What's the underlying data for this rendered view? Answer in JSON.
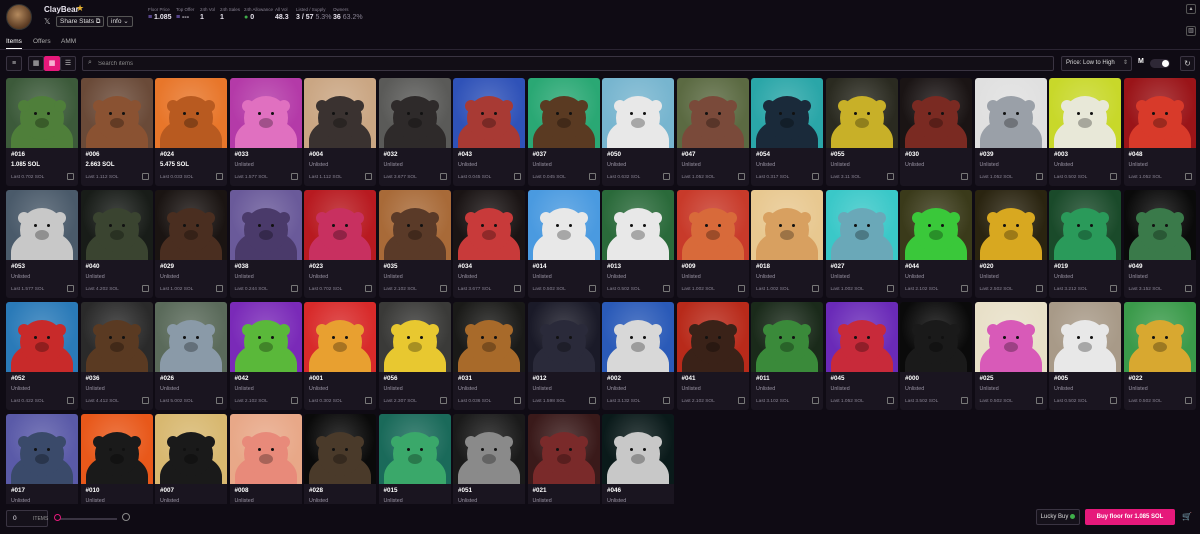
{
  "collection": {
    "name": "ClayBear",
    "star_icon": "star-icon",
    "social": "𝕏",
    "share_label": "Share Stats",
    "info_label": "info"
  },
  "stats": [
    {
      "label": "Floor Price",
      "value": "1.085",
      "dim": ""
    },
    {
      "label": "Top Offer",
      "value": "---",
      "dim": ""
    },
    {
      "label": "24h Vol",
      "value": "1",
      "dim": ""
    },
    {
      "label": "24h Sales",
      "value": "1",
      "dim": ""
    },
    {
      "label": "24h Allowance",
      "value": "0",
      "dim": ""
    },
    {
      "label": "All Vol",
      "value": "48.3",
      "dim": ""
    },
    {
      "label": "Listed / Supply",
      "value": "3 / 57",
      "dim": "5.3%"
    },
    {
      "label": "Owners",
      "value": "36",
      "dim": "63.2%"
    }
  ],
  "tabs": [
    {
      "label": "Items"
    },
    {
      "label": "Offers"
    },
    {
      "label": "AMM"
    }
  ],
  "toolbar": {
    "search_placeholder": "Search items",
    "sort_label": "Price: Low to High",
    "marketplace_mark": "M"
  },
  "colors": {
    "accent": "#e6197b",
    "bg": "#0f0b14",
    "card": "#1a1520"
  },
  "items": [
    {
      "id": "#016",
      "price": "1.085 SOL",
      "last": "Last 0.702 SOL",
      "bg": "#3c5a3a",
      "bear": "#4f7f3a"
    },
    {
      "id": "#006",
      "price": "2.663 SOL",
      "last": "Last 1.112 SOL",
      "bg": "#6a4a38",
      "bear": "#8a5232"
    },
    {
      "id": "#024",
      "price": "5.475 SOL",
      "last": "Last 0.033 SOL",
      "bg": "#e8762a",
      "bear": "#b85a20"
    },
    {
      "id": "#033",
      "price": "Unlisted",
      "last": "Last 1.577 SOL",
      "bg": "#b43aa8",
      "bear": "#e070c0"
    },
    {
      "id": "#004",
      "price": "Unlisted",
      "last": "Last 1.112 SOL",
      "bg": "#caa683",
      "bear": "#3a3230"
    },
    {
      "id": "#032",
      "price": "Unlisted",
      "last": "Last 3.677 SOL",
      "bg": "#5a5a58",
      "bear": "#2e2a2a"
    },
    {
      "id": "#043",
      "price": "Unlisted",
      "last": "Last 0.045 SOL",
      "bg": "#2f52b8",
      "bear": "#a83a34"
    },
    {
      "id": "#037",
      "price": "Unlisted",
      "last": "Last 0.045 SOL",
      "bg": "#2aa874",
      "bear": "#5a3a22"
    },
    {
      "id": "#050",
      "price": "Unlisted",
      "last": "Last 0.632 SOL",
      "bg": "#77b5cf",
      "bear": "#e8e8e8"
    },
    {
      "id": "#047",
      "price": "Unlisted",
      "last": "Last 1.052 SOL",
      "bg": "#5b6a42",
      "bear": "#7a4a3a"
    },
    {
      "id": "#054",
      "price": "Unlisted",
      "last": "Last 0.317 SOL",
      "bg": "#2aa6a8",
      "bear": "#1a2a3a"
    },
    {
      "id": "#055",
      "price": "Unlisted",
      "last": "Last 3.11 SOL",
      "bg": "#2a2a20",
      "bear": "#c8b028"
    },
    {
      "id": "#030",
      "price": "Unlisted",
      "last": "",
      "bg": "#1a1414",
      "bear": "#7a2a22"
    },
    {
      "id": "#039",
      "price": "Unlisted",
      "last": "Last 1.052 SOL",
      "bg": "#e0e0e0",
      "bear": "#9aa0a8"
    },
    {
      "id": "#003",
      "price": "Unlisted",
      "last": "Last 0.502 SOL",
      "bg": "#c8d82a",
      "bear": "#e8e8d8"
    },
    {
      "id": "#048",
      "price": "Unlisted",
      "last": "Last 1.052 SOL",
      "bg": "#9a1418",
      "bear": "#d83a2a"
    },
    {
      "id": "#053",
      "price": "Unlisted",
      "last": "Last 1.577 SOL",
      "bg": "#4a5a6a",
      "bear": "#c8c8c8"
    },
    {
      "id": "#040",
      "price": "Unlisted",
      "last": "Last 4.202 SOL",
      "bg": "#181c18",
      "bear": "#3a4430"
    },
    {
      "id": "#029",
      "price": "Unlisted",
      "last": "Last 1.002 SOL",
      "bg": "#1a1412",
      "bear": "#4a2e20"
    },
    {
      "id": "#038",
      "price": "Unlisted",
      "last": "Last 0.244 SOL",
      "bg": "#6a5a9a",
      "bear": "#4a3a6a"
    },
    {
      "id": "#023",
      "price": "Unlisted",
      "last": "Last 0.702 SOL",
      "bg": "#b81a20",
      "bear": "#c83060"
    },
    {
      "id": "#035",
      "price": "Unlisted",
      "last": "Last 2.102 SOL",
      "bg": "#a86a38",
      "bear": "#5a3a28"
    },
    {
      "id": "#034",
      "price": "Unlisted",
      "last": "Last 3.677 SOL",
      "bg": "#1a1414",
      "bear": "#c83a3a"
    },
    {
      "id": "#014",
      "price": "Unlisted",
      "last": "Last 0.502 SOL",
      "bg": "#4a9ae0",
      "bear": "#e8e8e8"
    },
    {
      "id": "#013",
      "price": "Unlisted",
      "last": "Last 0.502 SOL",
      "bg": "#2a6a3a",
      "bear": "#e8e8e8"
    },
    {
      "id": "#009",
      "price": "Unlisted",
      "last": "Last 1.002 SOL",
      "bg": "#c83a2a",
      "bear": "#d86a3a"
    },
    {
      "id": "#018",
      "price": "Unlisted",
      "last": "Last 1.002 SOL",
      "bg": "#e8c890",
      "bear": "#d8a060"
    },
    {
      "id": "#027",
      "price": "Unlisted",
      "last": "Last 1.002 SOL",
      "bg": "#3ac8c8",
      "bear": "#6aa8b8"
    },
    {
      "id": "#044",
      "price": "Unlisted",
      "last": "Last 2.102 SOL",
      "bg": "#3a3a1a",
      "bear": "#3ac83a"
    },
    {
      "id": "#020",
      "price": "Unlisted",
      "last": "Last 2.502 SOL",
      "bg": "#2a2410",
      "bear": "#d8a820"
    },
    {
      "id": "#019",
      "price": "Unlisted",
      "last": "Last 3.212 SOL",
      "bg": "#1a4a2a",
      "bear": "#2a9a5a"
    },
    {
      "id": "#049",
      "price": "Unlisted",
      "last": "Last 3.152 SOL",
      "bg": "#0a0a0a",
      "bear": "#3a7a4a"
    },
    {
      "id": "#052",
      "price": "Unlisted",
      "last": "Last 0.422 SOL",
      "bg": "#2a7ab8",
      "bear": "#c82a2a"
    },
    {
      "id": "#036",
      "price": "Unlisted",
      "last": "Last 4.412 SOL",
      "bg": "#2a2a2a",
      "bear": "#5a3a22"
    },
    {
      "id": "#026",
      "price": "Unlisted",
      "last": "Last 5.002 SOL",
      "bg": "#5a6a5a",
      "bear": "#8a9aa8"
    },
    {
      "id": "#042",
      "price": "Unlisted",
      "last": "Last 2.102 SOL",
      "bg": "#7a2ab8",
      "bear": "#5ab83a"
    },
    {
      "id": "#001",
      "price": "Unlisted",
      "last": "Last 0.302 SOL",
      "bg": "#d82a2a",
      "bear": "#e8a030"
    },
    {
      "id": "#056",
      "price": "Unlisted",
      "last": "Last 2.307 SOL",
      "bg": "#3a3a38",
      "bear": "#e8c830"
    },
    {
      "id": "#031",
      "price": "Unlisted",
      "last": "Last 0.036 SOL",
      "bg": "#1a1a18",
      "bear": "#a86a2a"
    },
    {
      "id": "#012",
      "price": "Unlisted",
      "last": "Last 1.598 SOL",
      "bg": "#1a1a28",
      "bear": "#2a2a3a"
    },
    {
      "id": "#002",
      "price": "Unlisted",
      "last": "Last 3.132 SOL",
      "bg": "#2a5ab8",
      "bear": "#d8d8d8"
    },
    {
      "id": "#041",
      "price": "Unlisted",
      "last": "Last 2.102 SOL",
      "bg": "#b82a1a",
      "bear": "#3a2218"
    },
    {
      "id": "#011",
      "price": "Unlisted",
      "last": "Last 3.102 SOL",
      "bg": "#1a2a1a",
      "bear": "#3a8a3a"
    },
    {
      "id": "#045",
      "price": "Unlisted",
      "last": "Last 1.052 SOL",
      "bg": "#6a2ab8",
      "bear": "#c82a3a"
    },
    {
      "id": "#000",
      "price": "Unlisted",
      "last": "Last 3.502 SOL",
      "bg": "#0a0a0a",
      "bear": "#1a1a1a"
    },
    {
      "id": "#025",
      "price": "Unlisted",
      "last": "Last 0.502 SOL",
      "bg": "#e8e0c8",
      "bear": "#d85ab8"
    },
    {
      "id": "#005",
      "price": "Unlisted",
      "last": "Last 0.502 SOL",
      "bg": "#a89a88",
      "bear": "#e8e8e8"
    },
    {
      "id": "#022",
      "price": "Unlisted",
      "last": "Last 0.502 SOL",
      "bg": "#3a9a4a",
      "bear": "#d8a830"
    },
    {
      "id": "#017",
      "price": "Unlisted",
      "last": "",
      "bg": "#5a5aa8",
      "bear": "#3a4a6a"
    },
    {
      "id": "#010",
      "price": "Unlisted",
      "last": "",
      "bg": "#e8581a",
      "bear": "#1a1a1a"
    },
    {
      "id": "#007",
      "price": "Unlisted",
      "last": "",
      "bg": "#d8b870",
      "bear": "#1a1a1a"
    },
    {
      "id": "#008",
      "price": "Unlisted",
      "last": "",
      "bg": "#e8a888",
      "bear": "#e88a7a"
    },
    {
      "id": "#028",
      "price": "Unlisted",
      "last": "",
      "bg": "#0a0a0a",
      "bear": "#4a3a2a"
    },
    {
      "id": "#015",
      "price": "Unlisted",
      "last": "",
      "bg": "#1a6a5a",
      "bear": "#3aa86a"
    },
    {
      "id": "#051",
      "price": "Unlisted",
      "last": "",
      "bg": "#1a1a1a",
      "bear": "#8a8a8a"
    },
    {
      "id": "#021",
      "price": "Unlisted",
      "last": "",
      "bg": "#3a1a1a",
      "bear": "#7a2a2a"
    },
    {
      "id": "#046",
      "price": "Unlisted",
      "last": "",
      "bg": "#0a1a1a",
      "bear": "#c8c8c8"
    }
  ],
  "footer": {
    "quantity": "0",
    "quantity_unit": "ITEMS",
    "slider_fraction": 0,
    "lucky_label": "Lucky Buy",
    "buy_label": "Buy floor for 1.085 SOL",
    "cart_icon": "cart-icon"
  }
}
